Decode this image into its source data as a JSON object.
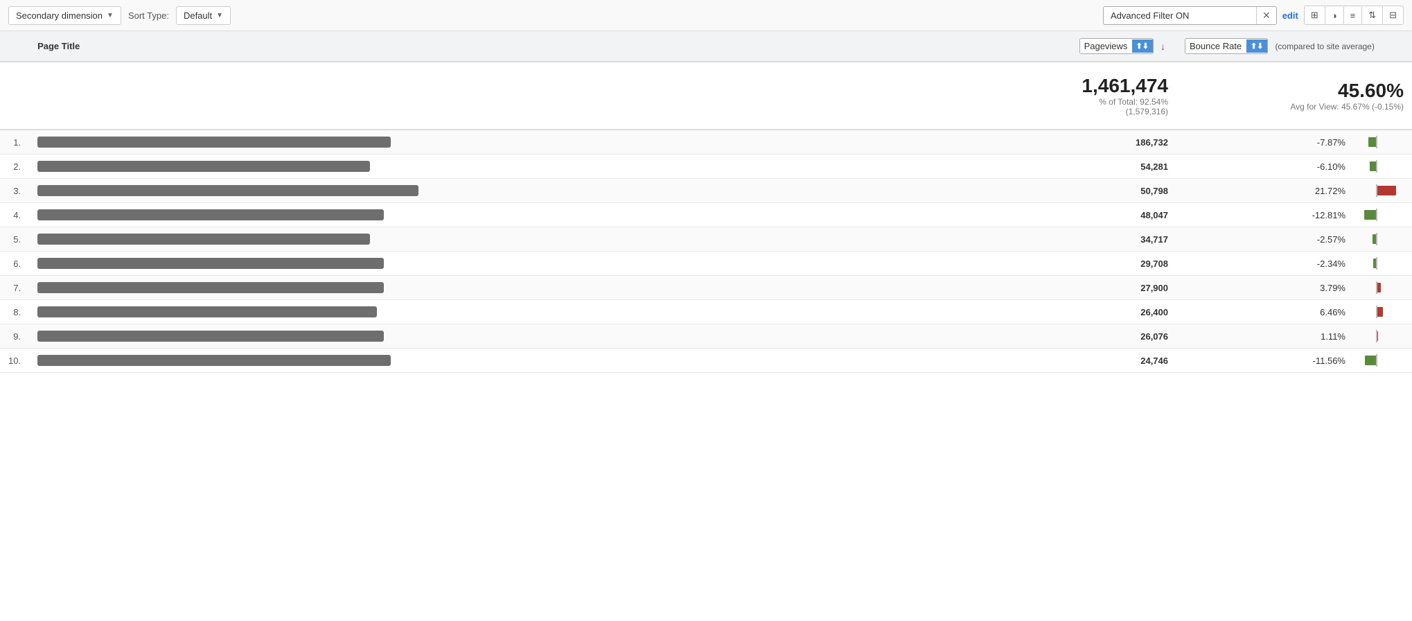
{
  "toolbar": {
    "secondary_dimension_label": "Secondary dimension",
    "sort_type_label": "Sort Type:",
    "sort_type_value": "Default",
    "advanced_filter_value": "Advanced Filter ON",
    "edit_label": "edit"
  },
  "view_icons": [
    "⊞",
    "◑",
    "≡",
    "⇅",
    "⊟"
  ],
  "header": {
    "page_title_col": "Page Title",
    "pageviews_option": "Pageviews",
    "bounce_rate_option": "Bounce Rate",
    "compared_label": "(compared to site average)"
  },
  "summary": {
    "total_pageviews": "1,461,474",
    "pageviews_sub": "% of Total: 92.54% (1,579,316)",
    "bounce_rate": "45.60%",
    "bounce_avg": "Avg for View: 45.67% (-0.15%)"
  },
  "rows": [
    {
      "num": "1.",
      "title_width": 510,
      "pageviews": "186,732",
      "bounce_pct": "-7.87%",
      "bar_type": "negative",
      "bar_pct": 30
    },
    {
      "num": "2.",
      "title_width": 480,
      "pageviews": "54,281",
      "bounce_pct": "-6.10%",
      "bar_type": "negative",
      "bar_pct": 24
    },
    {
      "num": "3.",
      "title_width": 550,
      "pageviews": "50,798",
      "bounce_pct": "21.72%",
      "bar_type": "positive",
      "bar_pct": 75
    },
    {
      "num": "4.",
      "title_width": 500,
      "pageviews": "48,047",
      "bounce_pct": "-12.81%",
      "bar_type": "negative",
      "bar_pct": 45
    },
    {
      "num": "5.",
      "title_width": 480,
      "pageviews": "34,717",
      "bounce_pct": "-2.57%",
      "bar_type": "negative",
      "bar_pct": 12
    },
    {
      "num": "6.",
      "title_width": 500,
      "pageviews": "29,708",
      "bounce_pct": "-2.34%",
      "bar_type": "negative",
      "bar_pct": 10
    },
    {
      "num": "7.",
      "title_width": 500,
      "pageviews": "27,900",
      "bounce_pct": "3.79%",
      "bar_type": "positive",
      "bar_pct": 18
    },
    {
      "num": "8.",
      "title_width": 490,
      "pageviews": "26,400",
      "bounce_pct": "6.46%",
      "bar_type": "positive",
      "bar_pct": 26
    },
    {
      "num": "9.",
      "title_width": 500,
      "pageviews": "26,076",
      "bounce_pct": "1.11%",
      "bar_type": "positive",
      "bar_pct": 8
    },
    {
      "num": "10.",
      "title_width": 510,
      "pageviews": "24,746",
      "bounce_pct": "-11.56%",
      "bar_type": "negative",
      "bar_pct": 42
    }
  ]
}
